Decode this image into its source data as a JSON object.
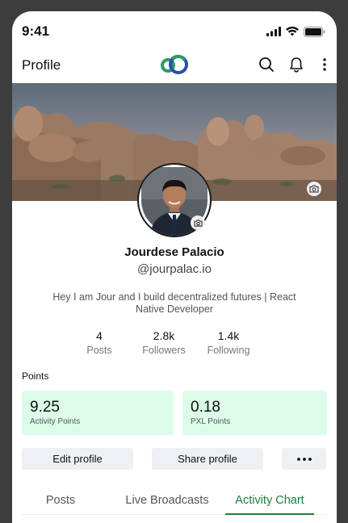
{
  "status_bar": {
    "time": "9:41",
    "icons": [
      "cellular-signal-icon",
      "wifi-icon",
      "battery-icon"
    ]
  },
  "app_bar": {
    "title": "Profile",
    "logo": "app-logo",
    "actions": [
      "search-icon",
      "bell-icon",
      "more-vertical-icon"
    ]
  },
  "profile": {
    "name": "Jourdese Palacio",
    "handle": "@jourpalac.io",
    "bio": "Hey I am Jour and I build decentralized futures | React Native Developer"
  },
  "stats": [
    {
      "value": "4",
      "label": "Posts"
    },
    {
      "value": "2.8k",
      "label": "Followers"
    },
    {
      "value": "1.4k",
      "label": "Following"
    }
  ],
  "points": {
    "title": "Points",
    "cards": [
      {
        "value": "9.25",
        "label": "Activity Points"
      },
      {
        "value": "0.18",
        "label": "PXL Points"
      }
    ]
  },
  "buttons": {
    "edit": "Edit profile",
    "share": "Share profile"
  },
  "tabs": [
    {
      "label": "Posts",
      "active": false
    },
    {
      "label": "Live Broadcasts",
      "active": false
    },
    {
      "label": "Activity Chart",
      "active": true
    }
  ],
  "colors": {
    "accent": "#1a7f3c",
    "points_card": "#dcfce9",
    "button_bg": "#eef0f3",
    "logo_green": "#2e9a6b",
    "logo_blue": "#2a4fa8"
  }
}
